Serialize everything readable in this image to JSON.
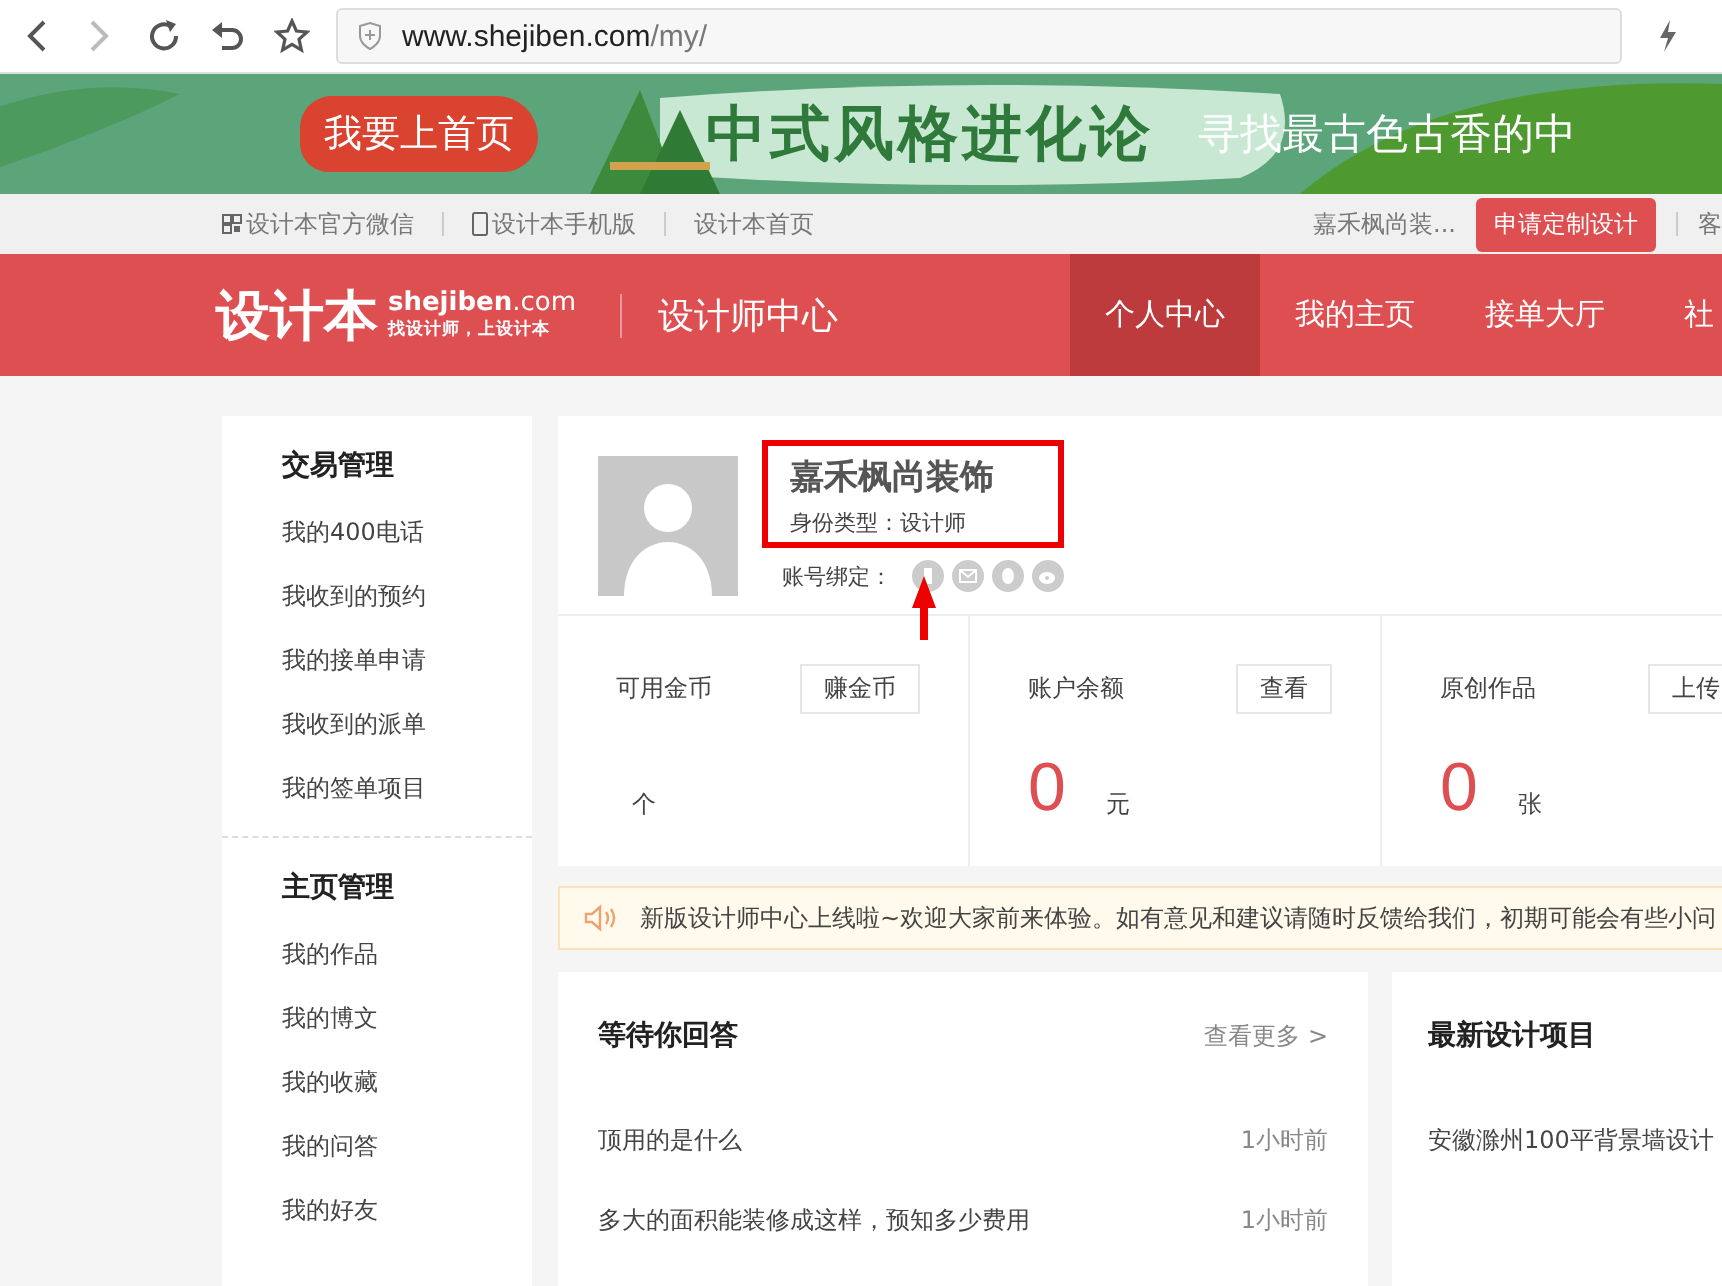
{
  "browser": {
    "url_host": "www.shejiben.com",
    "url_path": "/my/"
  },
  "banner": {
    "badge": "我要上首页",
    "title": "中式风格进化论",
    "slogan": "寻找最古色古香的中"
  },
  "topbar": {
    "links": [
      "设计本官方微信",
      "设计本手机版",
      "设计本首页"
    ],
    "user": "嘉禾枫尚装...",
    "cta": "申请定制设计",
    "cut": "客"
  },
  "header": {
    "logo": "设计本",
    "logo_domain": "shejiben",
    "logo_tld": ".com",
    "logo_tagline": "找设计师，上设计本",
    "section": "设计师中心",
    "nav": [
      {
        "label": "个人中心",
        "selected": true
      },
      {
        "label": "我的主页",
        "selected": false
      },
      {
        "label": "接单大厅",
        "selected": false
      },
      {
        "label": "社",
        "selected": false
      }
    ]
  },
  "sidebar": [
    {
      "title": "交易管理",
      "items": [
        "我的400电话",
        "我收到的预约",
        "我的接单申请",
        "我收到的派单",
        "我的签单项目"
      ]
    },
    {
      "title": "主页管理",
      "items": [
        "我的作品",
        "我的博文",
        "我的收藏",
        "我的问答",
        "我的好友"
      ]
    }
  ],
  "profile": {
    "name": "嘉禾枫尚装饰",
    "type_label": "身份类型：设计师",
    "bind_label": "账号绑定："
  },
  "stats": [
    {
      "label": "可用金币",
      "button": "赚金币",
      "unit": "个"
    },
    {
      "label": "账户余额",
      "button": "查看",
      "value": "0",
      "unit": "元"
    },
    {
      "label": "原创作品",
      "button": "上传",
      "value": "0",
      "unit": "张"
    }
  ],
  "notice": "新版设计师中心上线啦~欢迎大家前来体验。如有意见和建议请随时反馈给我们，初期可能会有些小问",
  "questions": {
    "title": "等待你回答",
    "more": "查看更多 >",
    "rows": [
      {
        "text": "顶用的是什么",
        "time": "1小时前"
      },
      {
        "text": "多大的面积能装修成这样，预知多少费用",
        "time": "1小时前"
      }
    ]
  },
  "projects": {
    "title": "最新设计项目",
    "rows": [
      "安徽滁州100平背景墙设计"
    ]
  }
}
